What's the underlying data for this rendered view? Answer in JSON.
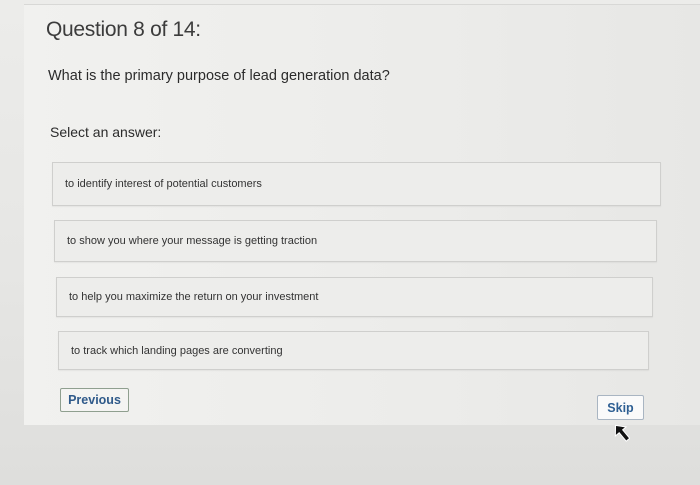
{
  "quiz": {
    "header": "Question 8 of 14:",
    "question": "What is the primary purpose of lead generation data?",
    "select_label": "Select an answer:",
    "options": [
      {
        "label": "to identify interest of potential customers"
      },
      {
        "label": "to show you where your message is getting traction"
      },
      {
        "label": "to help you maximize the return on your investment"
      },
      {
        "label": "to track which landing pages are converting"
      }
    ],
    "previous_label": "Previous",
    "skip_label": "Skip"
  },
  "icons": {
    "cursor": "mouse-pointer-icon"
  }
}
